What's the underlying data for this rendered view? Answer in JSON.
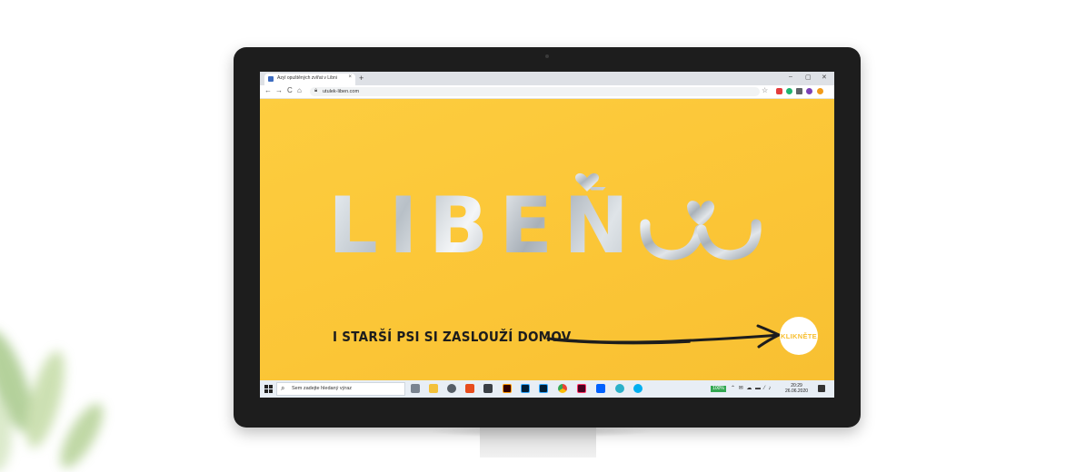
{
  "browser": {
    "tab_title": "Azyl opuštěných zvířat v Libni",
    "new_tab_glyph": "+",
    "tab_close_glyph": "×",
    "minimize_glyph": "–",
    "maximize_glyph": "▢",
    "close_glyph": "✕",
    "back_glyph": "←",
    "forward_glyph": "→",
    "reload_glyph": "C",
    "home_glyph": "⌂",
    "url": "utulek-liben.com",
    "star_glyph": "☆"
  },
  "page": {
    "logo_text": "LIBEŇ",
    "tagline": "I STARŠÍ PSI SI ZASLOUŽÍ DOMOV",
    "cta_label": "KLIKNĚTE",
    "background_color": "#fcc839",
    "cta_text_color": "#f7be2f"
  },
  "taskbar": {
    "search_placeholder": "Sem zadejte hledaný výraz",
    "battery_label": "100%",
    "time": "20:29",
    "date": "26.06.2020",
    "apps": [
      "task-view-icon",
      "file-explorer-icon",
      "settings-icon",
      "office-icon",
      "store-icon",
      "illustrator-icon",
      "photoshop-icon",
      "lightroom-icon",
      "chrome-icon",
      "indesign-icon",
      "dropbox-icon",
      "edge-icon",
      "skype-icon"
    ]
  }
}
